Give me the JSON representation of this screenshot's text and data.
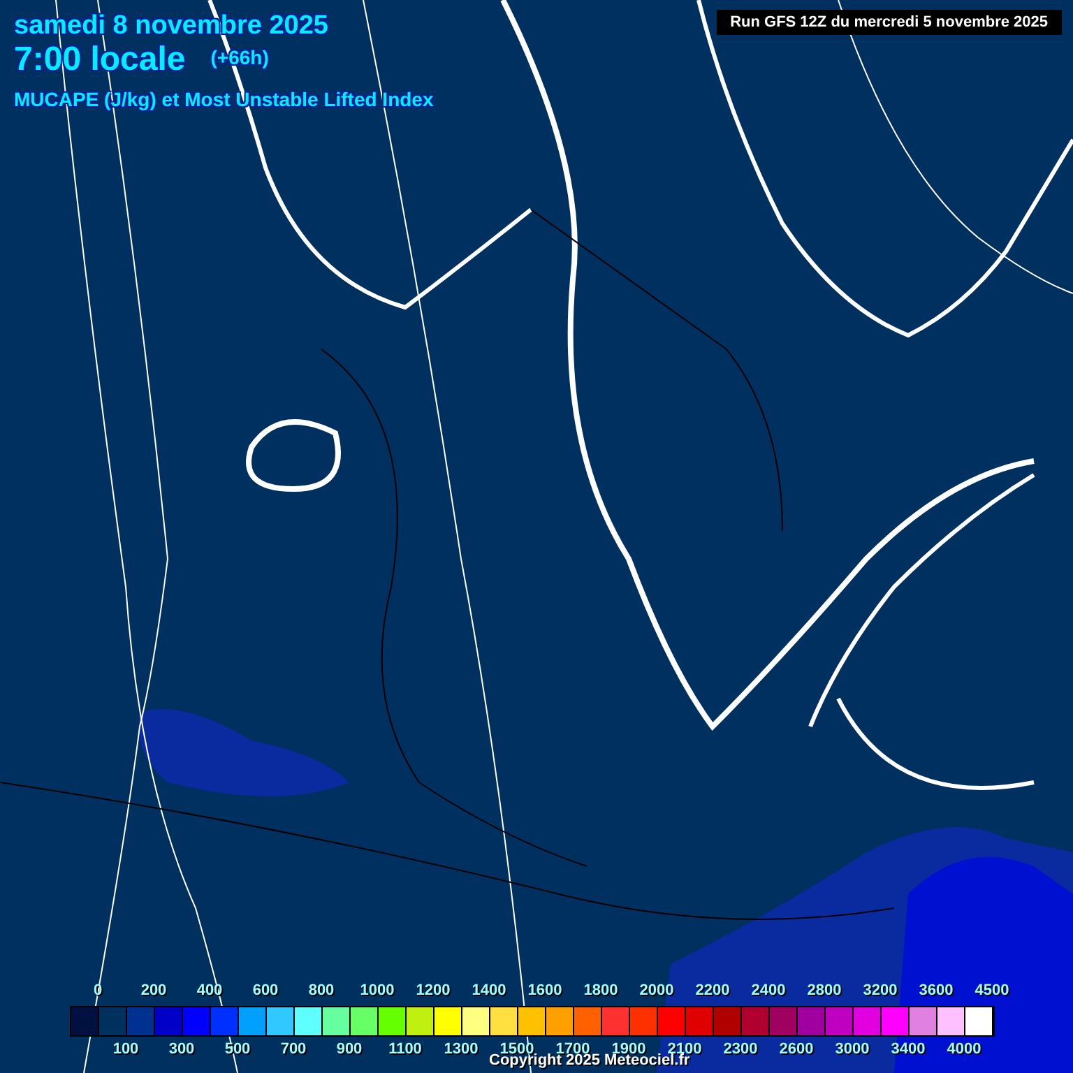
{
  "header": {
    "date": "samedi 8 novembre 2025",
    "time": "7:00 locale",
    "offset": "(+66h)",
    "title": "MUCAPE (J/kg) et Most Unstable Lifted Index"
  },
  "run_label": "Run GFS 12Z du mercredi 5 novembre 2025",
  "legend": {
    "swatches": [
      {
        "color": "#001040"
      },
      {
        "color": "#00305e"
      },
      {
        "color": "#003090"
      },
      {
        "color": "#0000c8"
      },
      {
        "color": "#0000ff"
      },
      {
        "color": "#0030ff"
      },
      {
        "color": "#00a0ff"
      },
      {
        "color": "#30c8ff"
      },
      {
        "color": "#60ffff"
      },
      {
        "color": "#66ffa0"
      },
      {
        "color": "#66ff66"
      },
      {
        "color": "#66ff00"
      },
      {
        "color": "#c0f010"
      },
      {
        "color": "#ffff00"
      },
      {
        "color": "#ffff80"
      },
      {
        "color": "#ffe040"
      },
      {
        "color": "#ffc000"
      },
      {
        "color": "#ffa000"
      },
      {
        "color": "#ff6000"
      },
      {
        "color": "#ff3030"
      },
      {
        "color": "#ff3000"
      },
      {
        "color": "#ff0000"
      },
      {
        "color": "#e00000"
      },
      {
        "color": "#b00000"
      },
      {
        "color": "#b00030"
      },
      {
        "color": "#a00060"
      },
      {
        "color": "#a000a0"
      },
      {
        "color": "#c000c0"
      },
      {
        "color": "#e000e0"
      },
      {
        "color": "#ff00ff"
      },
      {
        "color": "#e080e0"
      },
      {
        "color": "#ffc0ff"
      },
      {
        "color": "#ffffff"
      }
    ],
    "top_labels": [
      "0",
      "200",
      "400",
      "600",
      "800",
      "1000",
      "1200",
      "1400",
      "1600",
      "1800",
      "2000",
      "2200",
      "2400",
      "2800",
      "3200",
      "3600",
      "4500"
    ],
    "bottom_labels": [
      "100",
      "300",
      "500",
      "700",
      "900",
      "1100",
      "1300",
      "1500",
      "1700",
      "1900",
      "2100",
      "2300",
      "2600",
      "3000",
      "3400",
      "4000"
    ]
  },
  "copyright": "Copyright 2025 Meteociel.fr"
}
